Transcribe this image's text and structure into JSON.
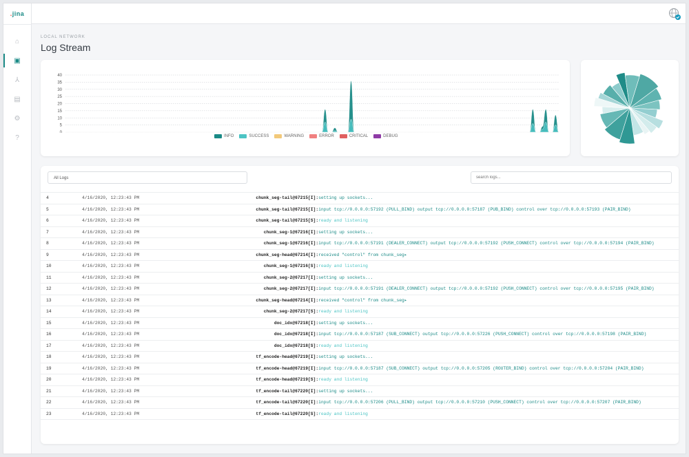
{
  "brand": {
    "logo_text": ".jina",
    "accent": "#1a8a86"
  },
  "sidebar": {
    "items": [
      {
        "name": "home-icon",
        "glyph": "⌂",
        "active": false
      },
      {
        "name": "log-stream-icon",
        "glyph": "▣",
        "active": true
      },
      {
        "name": "flow-icon",
        "glyph": "⅄",
        "active": false
      },
      {
        "name": "hub-icon",
        "glyph": "▤",
        "active": false
      },
      {
        "name": "settings-icon",
        "glyph": "⚙",
        "active": false
      },
      {
        "name": "help-icon",
        "glyph": "?",
        "active": false
      }
    ]
  },
  "header": {
    "subtitle": "LOCAL NETWORK",
    "title": "Log Stream"
  },
  "chart_data": {
    "type": "area",
    "y_ticks": [
      "40",
      "35",
      "30",
      "25",
      "20",
      "15",
      "10",
      "5",
      "0"
    ],
    "ylim": [
      0,
      40
    ],
    "legend": [
      {
        "label": "INFO",
        "color": "#1a8a86"
      },
      {
        "label": "SUCCESS",
        "color": "#4cc4c4"
      },
      {
        "label": "WARNING",
        "color": "#f2c97a"
      },
      {
        "label": "ERROR",
        "color": "#f08080"
      },
      {
        "label": "CRITICAL",
        "color": "#e06060"
      },
      {
        "label": "DEBUG",
        "color": "#8e3ba6"
      }
    ],
    "series": [
      {
        "name": "INFO",
        "values": [
          0,
          0,
          0,
          0,
          0,
          0,
          0,
          0,
          0,
          0,
          0,
          0,
          0,
          0,
          0,
          0,
          0,
          0,
          0,
          0,
          0,
          0,
          0,
          0,
          0,
          0,
          0,
          0,
          0,
          0,
          0,
          0,
          0,
          0,
          0,
          0,
          0,
          0,
          0,
          0,
          0,
          0,
          0,
          0,
          0,
          0,
          0,
          0,
          0,
          0,
          0,
          0,
          0,
          0,
          0,
          0,
          0,
          0,
          0,
          0,
          0,
          0,
          0,
          0,
          0,
          0,
          0,
          0,
          0,
          0,
          0,
          0,
          0,
          0,
          0,
          0,
          0,
          0,
          0,
          0,
          16,
          0,
          0,
          3,
          0,
          0,
          0,
          0,
          36,
          0,
          0,
          0,
          0,
          0,
          0,
          0,
          0,
          0,
          0,
          0,
          0,
          0,
          0,
          0,
          0,
          0,
          0,
          0,
          0,
          0,
          0,
          0,
          0,
          0,
          0,
          0,
          0,
          0,
          0,
          0,
          0,
          0,
          0,
          0,
          0,
          0,
          0,
          0,
          0,
          0,
          0,
          0,
          0,
          0,
          0,
          0,
          0,
          0,
          0,
          0,
          0,
          0,
          0,
          0,
          16,
          0,
          0,
          4,
          16,
          0,
          0,
          12,
          0
        ]
      },
      {
        "name": "SUCCESS",
        "values": [
          0,
          0,
          0,
          0,
          0,
          0,
          0,
          0,
          0,
          0,
          0,
          0,
          0,
          0,
          0,
          0,
          0,
          0,
          0,
          0,
          0,
          0,
          0,
          0,
          0,
          0,
          0,
          0,
          0,
          0,
          0,
          0,
          0,
          0,
          0,
          0,
          0,
          0,
          0,
          0,
          0,
          0,
          0,
          0,
          0,
          0,
          0,
          0,
          0,
          0,
          0,
          0,
          0,
          0,
          0,
          0,
          0,
          0,
          0,
          0,
          0,
          0,
          0,
          0,
          0,
          0,
          0,
          0,
          0,
          0,
          0,
          0,
          0,
          0,
          0,
          0,
          0,
          0,
          0,
          0,
          7,
          0,
          0,
          1,
          0,
          0,
          0,
          0,
          9,
          0,
          0,
          0,
          0,
          0,
          0,
          0,
          0,
          0,
          0,
          0,
          0,
          0,
          0,
          0,
          0,
          0,
          0,
          0,
          0,
          0,
          0,
          0,
          0,
          0,
          0,
          0,
          0,
          0,
          0,
          0,
          0,
          0,
          0,
          0,
          0,
          0,
          0,
          0,
          0,
          0,
          0,
          0,
          0,
          0,
          0,
          0,
          0,
          0,
          0,
          0,
          0,
          0,
          0,
          0,
          6,
          0,
          0,
          2,
          7,
          0,
          0,
          5,
          0
        ]
      }
    ]
  },
  "pie_data": {
    "type": "pie",
    "slices": [
      {
        "value": 10,
        "color": "#4fa8a4"
      },
      {
        "value": 6,
        "color": "#5fb3b0"
      },
      {
        "value": 5,
        "color": "#7cc3c0"
      },
      {
        "value": 5,
        "color": "#93ced0"
      },
      {
        "value": 4,
        "color": "#b7dfe0"
      },
      {
        "value": 4,
        "color": "#d3ecec"
      },
      {
        "value": 3,
        "color": "#e8f4f4"
      },
      {
        "value": 6,
        "color": "#c3e5e6"
      },
      {
        "value": 7,
        "color": "#2f9894"
      },
      {
        "value": 9,
        "color": "#3fa19d"
      },
      {
        "value": 8,
        "color": "#66b8b5"
      },
      {
        "value": 4,
        "color": "#d8eeee"
      },
      {
        "value": 4,
        "color": "#eef7f7"
      },
      {
        "value": 3,
        "color": "#a6d6d7"
      },
      {
        "value": 6,
        "color": "#58afab"
      },
      {
        "value": 5,
        "color": "#8ccbcb"
      },
      {
        "value": 4,
        "color": "#1f8c88"
      },
      {
        "value": 7,
        "color": "#6fbdba"
      }
    ]
  },
  "logs": {
    "filter_value": "All Logs",
    "search_placeholder": "search logs...",
    "rows": [
      {
        "idx": "4",
        "time": "4/16/2020, 12:23:43 PM",
        "name": "chunk_seg-tail@67215",
        "lvl": "[I]:",
        "msg": "setting up sockets...",
        "type": "I"
      },
      {
        "idx": "5",
        "time": "4/16/2020, 12:23:43 PM",
        "name": "chunk_seg-tail@67215",
        "lvl": "[I]:",
        "msg": "input tcp://0.0.0.0:57192 (PULL_BIND) output tcp://0.0.0.0:57187 (PUB_BIND) control over tcp://0.0.0.0:57193 (PAIR_BIND)",
        "type": "I"
      },
      {
        "idx": "6",
        "time": "4/16/2020, 12:23:43 PM",
        "name": "chunk_seg-tail@67215",
        "lvl": "[S]:",
        "msg": "ready and listening",
        "type": "S"
      },
      {
        "idx": "7",
        "time": "4/16/2020, 12:23:43 PM",
        "name": "chunk_seg-1@67216",
        "lvl": "[I]:",
        "msg": "setting up sockets...",
        "type": "I"
      },
      {
        "idx": "8",
        "time": "4/16/2020, 12:23:43 PM",
        "name": "chunk_seg-1@67216",
        "lvl": "[I]:",
        "msg": "input tcp://0.0.0.0:57191 (DEALER_CONNECT) output tcp://0.0.0.0:57192 (PUSH_CONNECT) control over tcp://0.0.0.0:57194 (PAIR_BIND)",
        "type": "I"
      },
      {
        "idx": "9",
        "time": "4/16/2020, 12:23:43 PM",
        "name": "chunk_seg-head@67214",
        "lvl": "[I]:",
        "msg": "received \"control\" from chunk_seg▸",
        "type": "I"
      },
      {
        "idx": "10",
        "time": "4/16/2020, 12:23:43 PM",
        "name": "chunk_seg-1@67216",
        "lvl": "[S]:",
        "msg": "ready and listening",
        "type": "S"
      },
      {
        "idx": "11",
        "time": "4/16/2020, 12:23:43 PM",
        "name": "chunk_seg-2@67217",
        "lvl": "[I]:",
        "msg": "setting up sockets...",
        "type": "I"
      },
      {
        "idx": "12",
        "time": "4/16/2020, 12:23:43 PM",
        "name": "chunk_seg-2@67217",
        "lvl": "[I]:",
        "msg": "input tcp://0.0.0.0:57191 (DEALER_CONNECT) output tcp://0.0.0.0:57192 (PUSH_CONNECT) control over tcp://0.0.0.0:57195 (PAIR_BIND)",
        "type": "I"
      },
      {
        "idx": "13",
        "time": "4/16/2020, 12:23:43 PM",
        "name": "chunk_seg-head@67214",
        "lvl": "[I]:",
        "msg": "received \"control\" from chunk_seg▸",
        "type": "I"
      },
      {
        "idx": "14",
        "time": "4/16/2020, 12:23:43 PM",
        "name": "chunk_seg-2@67217",
        "lvl": "[S]:",
        "msg": "ready and listening",
        "type": "S"
      },
      {
        "idx": "15",
        "time": "4/16/2020, 12:23:43 PM",
        "name": "doc_idx@67218",
        "lvl": "[I]:",
        "msg": "setting up sockets...",
        "type": "I"
      },
      {
        "idx": "16",
        "time": "4/16/2020, 12:23:43 PM",
        "name": "doc_idx@67218",
        "lvl": "[I]:",
        "msg": "input tcp://0.0.0.0:57187 (SUB_CONNECT) output tcp://0.0.0.0:57226 (PUSH_CONNECT) control over tcp://0.0.0.0:57198 (PAIR_BIND)",
        "type": "I"
      },
      {
        "idx": "17",
        "time": "4/16/2020, 12:23:43 PM",
        "name": "doc_idx@67218",
        "lvl": "[S]:",
        "msg": "ready and listening",
        "type": "S"
      },
      {
        "idx": "18",
        "time": "4/16/2020, 12:23:43 PM",
        "name": "tf_encode-head@67219",
        "lvl": "[I]:",
        "msg": "setting up sockets...",
        "type": "I"
      },
      {
        "idx": "19",
        "time": "4/16/2020, 12:23:43 PM",
        "name": "tf_encode-head@67219",
        "lvl": "[I]:",
        "msg": "input tcp://0.0.0.0:57187 (SUB_CONNECT) output tcp://0.0.0.0:57205 (ROUTER_BIND) control over tcp://0.0.0.0:57204 (PAIR_BIND)",
        "type": "I"
      },
      {
        "idx": "20",
        "time": "4/16/2020, 12:23:43 PM",
        "name": "tf_encode-head@67219",
        "lvl": "[S]:",
        "msg": "ready and listening",
        "type": "S"
      },
      {
        "idx": "21",
        "time": "4/16/2020, 12:23:43 PM",
        "name": "tf_encode-tail@67220",
        "lvl": "[I]:",
        "msg": "setting up sockets...",
        "type": "I"
      },
      {
        "idx": "22",
        "time": "4/16/2020, 12:23:43 PM",
        "name": "tf_encode-tail@67220",
        "lvl": "[I]:",
        "msg": "input tcp://0.0.0.0:57206 (PULL_BIND) output tcp://0.0.0.0:57210 (PUSH_CONNECT) control over tcp://0.0.0.0:57207 (PAIR_BIND)",
        "type": "I"
      },
      {
        "idx": "23",
        "time": "4/16/2020, 12:23:43 PM",
        "name": "tf_encode-tail@67220",
        "lvl": "[S]:",
        "msg": "ready and listening",
        "type": "S"
      }
    ]
  }
}
